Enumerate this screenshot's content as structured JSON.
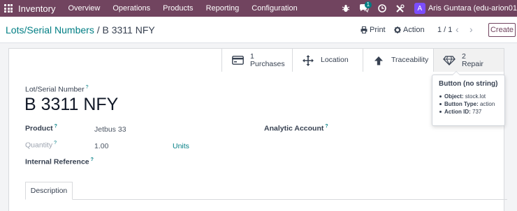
{
  "navbar": {
    "app_name": "Inventory",
    "menu": [
      "Overview",
      "Operations",
      "Products",
      "Reporting",
      "Configuration"
    ],
    "messages_badge": "1",
    "user_initial": "A",
    "user_name": "Aris Guntara (edu-arion01"
  },
  "control_panel": {
    "breadcrumb_parent": "Lots/Serial Numbers",
    "breadcrumb_separator": "/",
    "breadcrumb_current": "B 3311 NFY",
    "print_label": "Print",
    "action_label": "Action",
    "pager": "1 / 1",
    "create_label": "Create"
  },
  "smart_buttons": [
    {
      "count": "1",
      "label": "Purchases",
      "icon": "credit-card-icon"
    },
    {
      "count": "",
      "label": "Location",
      "icon": "arrows-move-icon"
    },
    {
      "count": "",
      "label": "Traceability",
      "icon": "arrow-up-icon"
    },
    {
      "count": "2",
      "label": "Repair",
      "icon": "diamond-icon"
    }
  ],
  "form": {
    "lot_label": "Lot/Serial Number",
    "lot_name": "B 3311 NFY",
    "product_label": "Product",
    "product_value": "Jetbus 33",
    "quantity_label": "Quantity",
    "quantity_value": "1.00",
    "uom_value": "Units",
    "internal_ref_label": "Internal Reference",
    "analytic_label": "Analytic Account",
    "help_mark": "?"
  },
  "tabs": [
    "Description"
  ],
  "tooltip": {
    "title": "Button (no string)",
    "rows": [
      {
        "key": "Object:",
        "value": "stock.lot"
      },
      {
        "key": "Button Type:",
        "value": "action"
      },
      {
        "key": "Action ID:",
        "value": "737"
      }
    ]
  },
  "colors": {
    "navbar": "#71445f",
    "link": "#017e84",
    "avatar": "#7c4dff"
  }
}
